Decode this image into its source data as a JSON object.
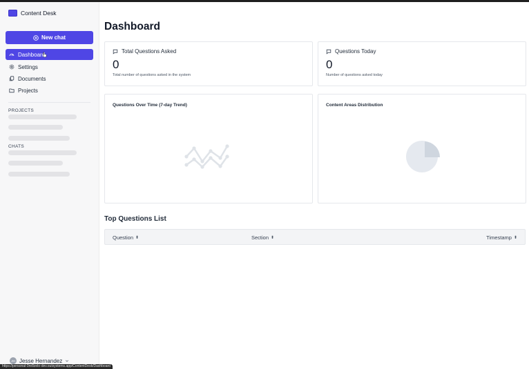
{
  "app": {
    "name": "Content Desk"
  },
  "sidebar": {
    "new_chat_label": "New chat",
    "nav": [
      {
        "label": "Dashboard",
        "icon": "gauge-icon",
        "active": true
      },
      {
        "label": "Settings",
        "icon": "gear-icon",
        "active": false
      },
      {
        "label": "Documents",
        "icon": "documents-icon",
        "active": false
      },
      {
        "label": "Projects",
        "icon": "folder-icon",
        "active": false
      }
    ],
    "projects_label": "PROJECTS",
    "chats_label": "CHATS",
    "user": {
      "initials": "JH",
      "name": "Jesse Hernandez"
    }
  },
  "status_bar": {
    "url": "https://personal-0re8zelo-dev.outsystems.app/ContentDesk/Dashboard"
  },
  "main": {
    "title": "Dashboard",
    "stats": [
      {
        "label": "Total Questions Asked",
        "value": "0",
        "description": "Total number of questions asked in the system",
        "icon": "chat-bubble-icon"
      },
      {
        "label": "Questions Today",
        "value": "0",
        "description": "Number of questions asked today",
        "icon": "chat-bubble-icon"
      }
    ],
    "charts": [
      {
        "title": "Questions Over Time (7-day Trend)",
        "placeholder_icon": "line-chart-placeholder-icon"
      },
      {
        "title": "Content Areas Distribution",
        "placeholder_icon": "pie-chart-placeholder-icon"
      }
    ],
    "top_questions": {
      "title": "Top Questions List",
      "columns": [
        "Question",
        "Section",
        "Timestamp"
      ]
    }
  },
  "colors": {
    "accent": "#4f46e5",
    "sidebar_bg": "#f7f7f8",
    "placeholder": "#dfe3e8"
  }
}
